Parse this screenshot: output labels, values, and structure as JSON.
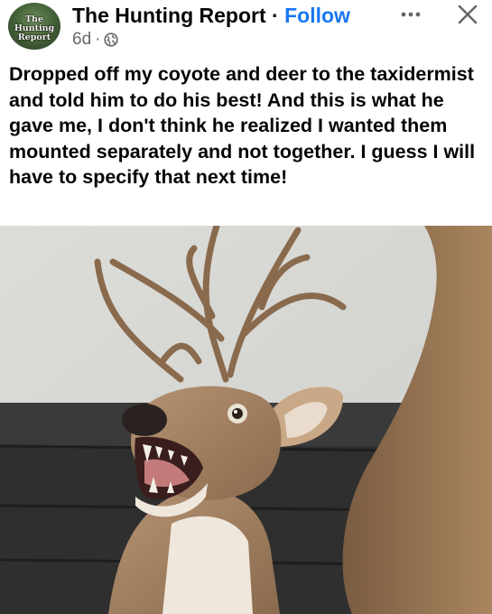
{
  "post": {
    "page_name": "The Hunting Report",
    "separator": "·",
    "follow_label": "Follow",
    "time_ago": "6d",
    "meta_separator": "·",
    "audience_icon": "globe-icon",
    "more_icon": "more-horizontal-icon",
    "close_icon": "close-icon",
    "avatar_text_line1": "The Hunting",
    "avatar_text_line2": "Report",
    "text": "Dropped off my coyote and deer to the taxidermist and told him to do his best! And this is what he gave me, I don't think he realized I wanted them mounted separately and not together. I guess I will have to specify that next time!"
  },
  "colors": {
    "link": "#1877f2",
    "meta": "#65676b",
    "text": "#050505"
  },
  "photo": {
    "subject": "taxidermy deer head with coyote snarling mouth mounted on wall"
  }
}
